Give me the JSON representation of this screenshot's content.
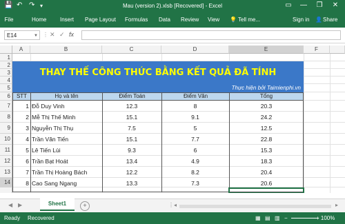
{
  "titlebar": {
    "title": "Mau (version 2).xlsb [Recovered] - Excel",
    "save_icon": "save-icon",
    "undo_icon": "undo-icon",
    "redo_icon": "redo-icon",
    "customize_icon": "customize-qat-icon",
    "options_icon": "ribbon-options-icon",
    "minimize": "—",
    "restore": "❐",
    "close": "✕"
  },
  "ribbon": {
    "tabs": [
      "File",
      "Home",
      "Insert",
      "Page Layout",
      "Formulas",
      "Data",
      "Review",
      "View"
    ],
    "tell_me": "Tell me...",
    "sign_in": "Sign in",
    "share": "Share"
  },
  "formula_bar": {
    "name_box": "E14",
    "cancel": "✕",
    "enter": "✓",
    "fx": "fx",
    "value": ""
  },
  "columns": [
    "A",
    "B",
    "C",
    "D",
    "E",
    "F"
  ],
  "rows": [
    "1",
    "2",
    "3",
    "4",
    "5",
    "6",
    "7",
    "8",
    "9",
    "10",
    "11",
    "12",
    "13",
    "14"
  ],
  "sheet": {
    "banner": "THAY THẾ CÔNG THỨC BẰNG KẾT QUẢ ĐÃ TÍNH",
    "credit": "Thực hiện bởi Taimienphi.vn",
    "headers": [
      "STT",
      "Họ và tên",
      "Điểm Toán",
      "Điểm Văn",
      "Tổng"
    ],
    "data": [
      [
        "1",
        "Đỗ Duy Vinh",
        "12.3",
        "8",
        "20.3"
      ],
      [
        "2",
        "Mễ Thị Thế Minh",
        "15.1",
        "9.1",
        "24.2"
      ],
      [
        "3",
        "Nguyễn Thị Thụ",
        "7.5",
        "5",
        "12.5"
      ],
      [
        "4",
        "Trần Văn Tiến",
        "15.1",
        "7.7",
        "22.8"
      ],
      [
        "5",
        "Lê Tiến Lùi",
        "9.3",
        "6",
        "15.3"
      ],
      [
        "6",
        "Trần Bạt Hoát",
        "13.4",
        "4.9",
        "18.3"
      ],
      [
        "7",
        "Trần Thị Hoàng Bách",
        "12.2",
        "8.2",
        "20.4"
      ],
      [
        "8",
        "Cao Sang Ngang",
        "13.3",
        "7.3",
        "20.6"
      ]
    ]
  },
  "sheet_tabs": {
    "active": "Sheet1",
    "add": "+"
  },
  "status": {
    "ready": "Recovered",
    "zoom": "+  100%"
  }
}
